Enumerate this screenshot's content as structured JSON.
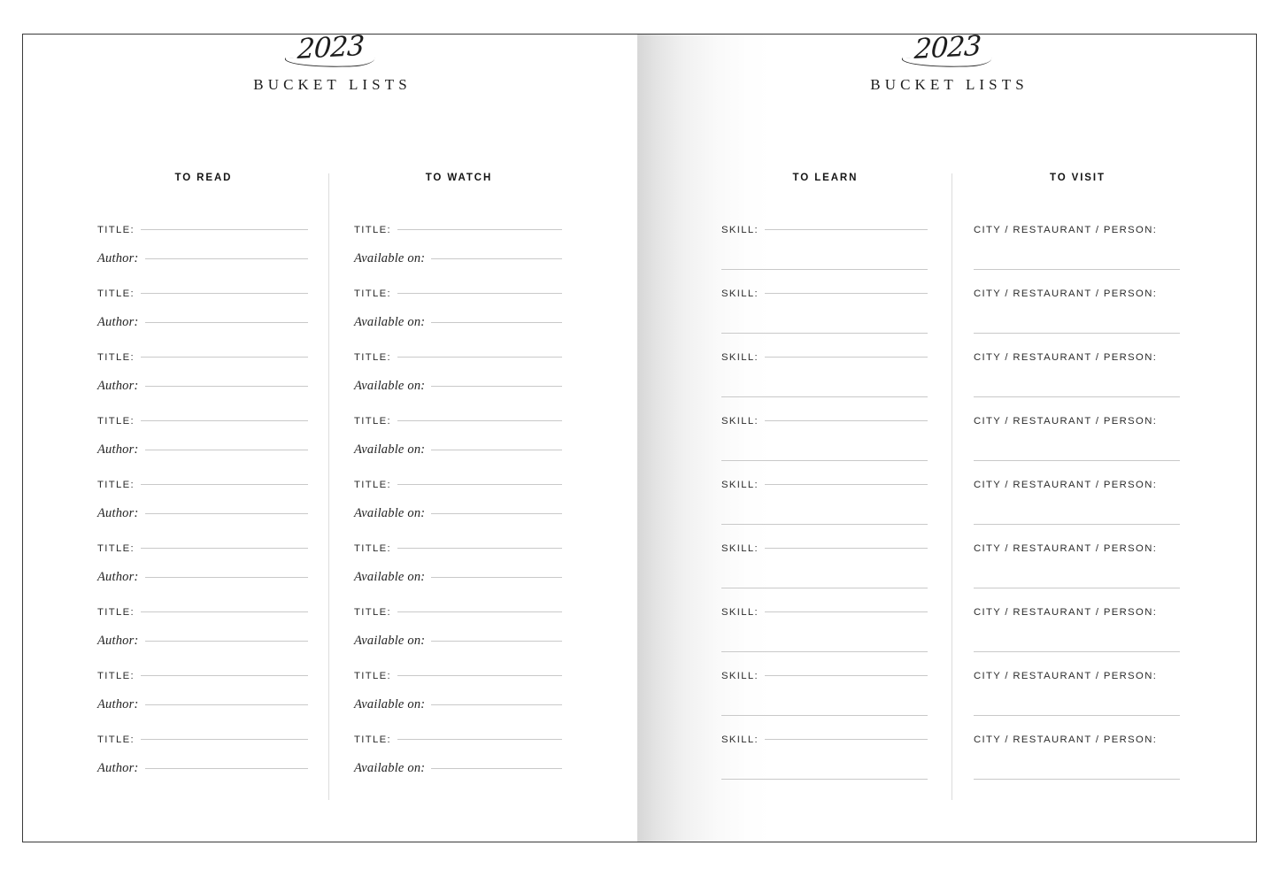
{
  "document": {
    "type": "planner-spread",
    "year_script": "2023",
    "masthead_title": "BUCKET LISTS"
  },
  "pages": {
    "left": {
      "year_script": "2023",
      "masthead_title": "BUCKET LISTS",
      "columns": [
        {
          "id": "to-read",
          "heading": "TO READ",
          "rows_count": 9,
          "fields": [
            {
              "label": "TITLE:",
              "style": "caps",
              "rule": "inline"
            },
            {
              "label": "Author:",
              "style": "italic",
              "rule": "inline"
            }
          ]
        },
        {
          "id": "to-watch",
          "heading": "TO WATCH",
          "rows_count": 9,
          "fields": [
            {
              "label": "TITLE:",
              "style": "caps",
              "rule": "inline"
            },
            {
              "label": "Available on:",
              "style": "italic",
              "rule": "inline"
            }
          ]
        }
      ]
    },
    "right": {
      "year_script": "2023",
      "masthead_title": "BUCKET LISTS",
      "columns": [
        {
          "id": "to-learn",
          "heading": "TO LEARN",
          "rows_count": 9,
          "fields": [
            {
              "label": "SKILL:",
              "style": "caps",
              "rule": "inline"
            },
            {
              "label": "",
              "style": "none",
              "rule": "full"
            }
          ]
        },
        {
          "id": "to-visit",
          "heading": "TO VISIT",
          "rows_count": 9,
          "fields": [
            {
              "label": "CITY / RESTAURANT / PERSON:",
              "style": "caps",
              "rule": "none"
            },
            {
              "label": "",
              "style": "none",
              "rule": "full"
            }
          ]
        }
      ]
    }
  },
  "colors": {
    "page_background": "#ffffff",
    "border": "#3a3a3a",
    "rule_line": "#c9c9c9",
    "divider": "#dcdcdc",
    "text": "#1c1c1c",
    "label_text": "#2b2b2b"
  }
}
